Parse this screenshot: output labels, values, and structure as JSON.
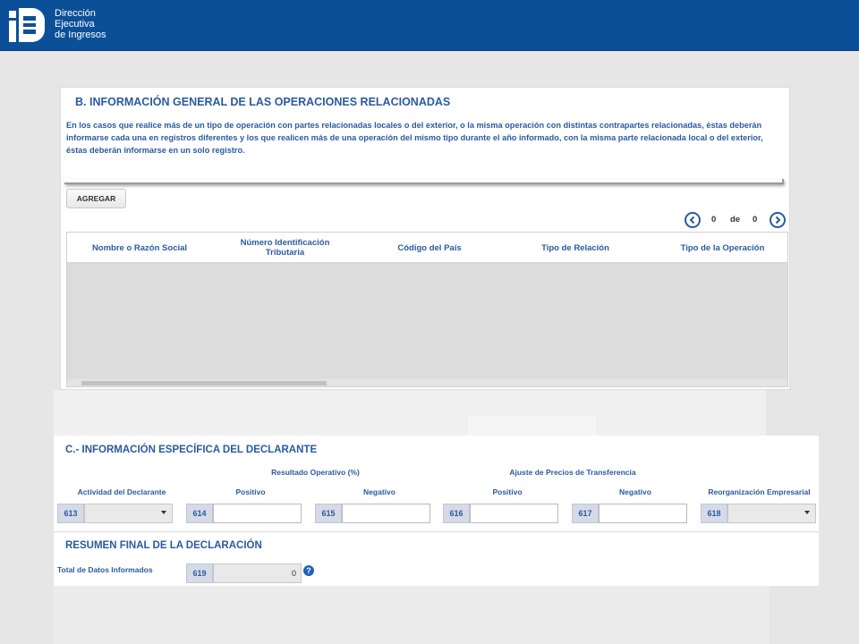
{
  "header": {
    "logo_lines": [
      "Dirección",
      "Ejecutiva",
      "de Ingresos"
    ]
  },
  "section_b": {
    "title": "B. INFORMACIÓN GENERAL DE LAS OPERACIONES RELACIONADAS",
    "description": "En los casos que realice más de un tipo de operación con partes relacionadas locales o del exterior, o la misma operación con distintas contrapartes relacionadas, éstas deberán informarse cada una en registros diferentes y los que realicen más de una operación del mismo tipo durante el año informado, con la misma parte relacionada local o del exterior, éstas deberán informarse en un solo registro.",
    "add_button": "AGREGAR",
    "pager": {
      "current": "0",
      "separator": "de",
      "total": "0"
    },
    "columns": [
      "Nombre o Razón Social",
      "Número Identificación Tributaria",
      "Código del País",
      "Tipo de Relación",
      "Tipo de la Operación"
    ]
  },
  "section_c": {
    "title": "C.- INFORMACIÓN ESPECÍFICA DEL DECLARANTE",
    "group_resultado": "Resultado Operativo (%)",
    "group_ajuste": "Ajuste de Precios de Transferencia",
    "labels": {
      "actividad": "Actividad del Declarante",
      "positivo_1": "Positivo",
      "negativo_1": "Negativo",
      "positivo_2": "Positivo",
      "negativo_2": "Negativo",
      "reorganizacion": "Reorganización Empresarial"
    },
    "codes": {
      "actividad": "613",
      "positivo_1": "614",
      "negativo_1": "615",
      "positivo_2": "616",
      "negativo_2": "617",
      "reorganizacion": "618"
    },
    "values": {
      "positivo_1": "",
      "negativo_1": "",
      "positivo_2": "",
      "negativo_2": ""
    }
  },
  "resumen": {
    "title": "RESUMEN FINAL DE LA DECLARACIÓN",
    "total_label": "Total de Datos Informados",
    "total_code": "619",
    "total_value": "0",
    "help_symbol": "?"
  },
  "colors": {
    "header_bg": "#0b4f98",
    "accent_text": "#2a5aa0",
    "code_bg": "#d5dbe6",
    "grid_body": "#dcdcdc"
  }
}
